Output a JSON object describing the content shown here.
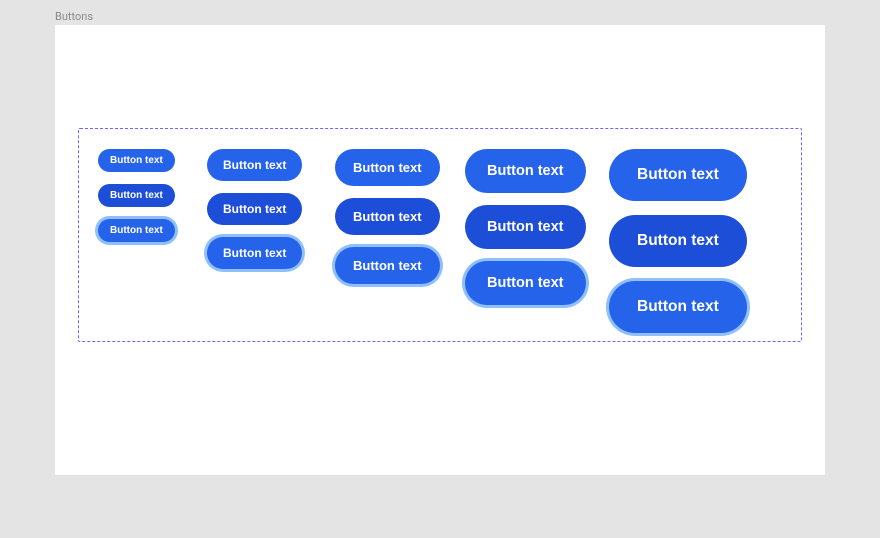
{
  "frame_label": "Buttons",
  "columns": [
    {
      "buttons": [
        {
          "label": "Button text"
        },
        {
          "label": "Button text"
        },
        {
          "label": "Button text"
        }
      ]
    },
    {
      "buttons": [
        {
          "label": "Button text"
        },
        {
          "label": "Button text"
        },
        {
          "label": "Button text"
        }
      ]
    },
    {
      "buttons": [
        {
          "label": "Button text"
        },
        {
          "label": "Button text"
        },
        {
          "label": "Button text"
        }
      ]
    },
    {
      "buttons": [
        {
          "label": "Button text"
        },
        {
          "label": "Button text"
        },
        {
          "label": "Button text"
        }
      ]
    },
    {
      "buttons": [
        {
          "label": "Button text"
        },
        {
          "label": "Button text"
        },
        {
          "label": "Button text"
        }
      ]
    }
  ]
}
